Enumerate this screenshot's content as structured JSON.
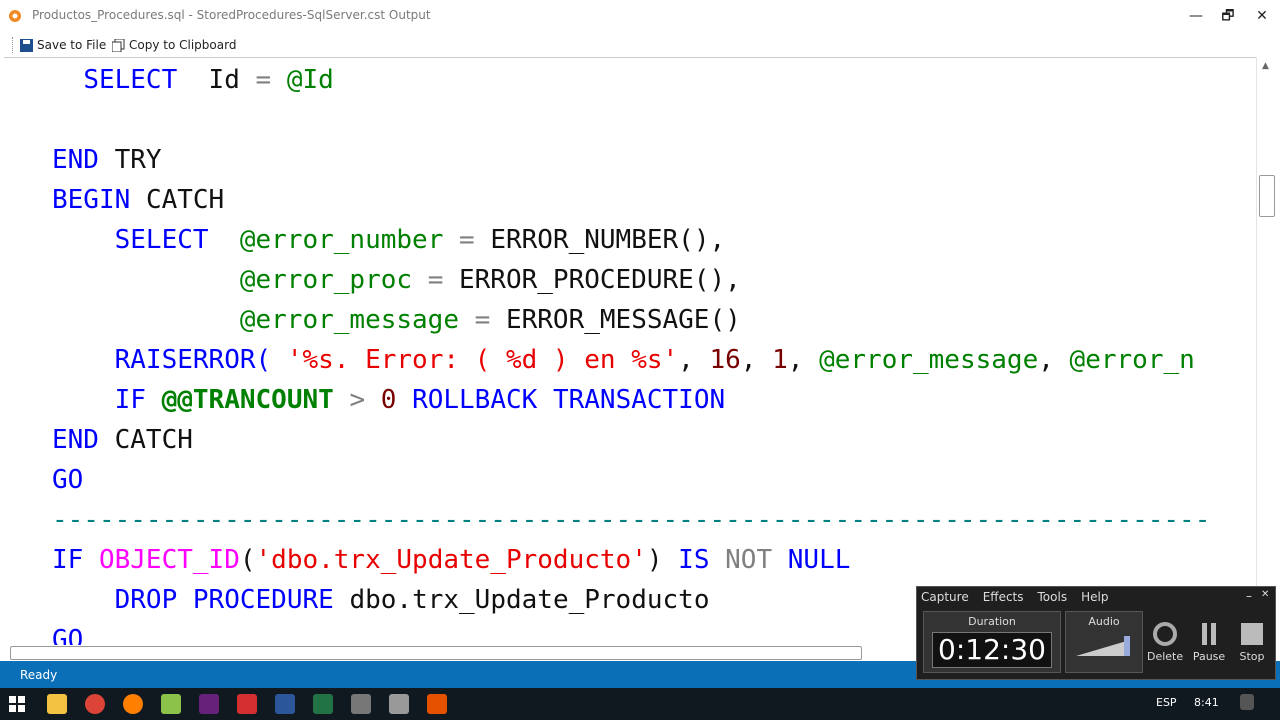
{
  "window": {
    "title": "Productos_Procedures.sql - StoredProcedures-SqlServer.cst Output",
    "minimize": "—",
    "maximize": "🗗",
    "close": "✕"
  },
  "toolbar": {
    "save_label": "Save to File",
    "copy_label": "Copy to Clipboard"
  },
  "code": {
    "l1": [
      "SELECT",
      "Id",
      "=",
      "@Id"
    ],
    "l3": [
      "END",
      "TRY"
    ],
    "l4": [
      "BEGIN",
      "CATCH"
    ],
    "l5": [
      "SELECT",
      "@error_number",
      "=",
      "ERROR_NUMBER(),"
    ],
    "l6": [
      "@error_proc",
      "=",
      "ERROR_PROCEDURE(),"
    ],
    "l7": [
      "@error_message",
      "=",
      "ERROR_MESSAGE()"
    ],
    "l8": [
      "RAISERROR(",
      "'%s. Error: ( %d ) en %s'",
      ",",
      "16",
      ",",
      "1",
      ",",
      "@error_message",
      ",",
      "@error_n"
    ],
    "l9": [
      "IF",
      "@@TRANCOUNT",
      ">",
      "0",
      "ROLLBACK",
      "TRANSACTION"
    ],
    "l10": [
      "END",
      "CATCH"
    ],
    "l11": [
      "GO"
    ],
    "l12": "--------------------------------------------------------------------------",
    "l13": [
      "IF",
      "OBJECT_ID",
      "(",
      "'dbo.trx_Update_Producto'",
      ")",
      "IS",
      "NOT",
      "NULL"
    ],
    "l14": [
      "DROP",
      "PROCEDURE",
      "dbo.trx_Update_Producto"
    ],
    "l15": [
      "GO"
    ]
  },
  "status": {
    "text": "Ready"
  },
  "recorder": {
    "menu": [
      "Capture",
      "Effects",
      "Tools",
      "Help"
    ],
    "duration_label": "Duration",
    "duration_value": "0:12:30",
    "audio_label": "Audio",
    "delete_label": "Delete",
    "pause_label": "Pause",
    "stop_label": "Stop",
    "close": "✕",
    "minimize": "–"
  },
  "taskbar": {
    "language": "ESP",
    "time": "8:41",
    "icons": [
      "windows-start",
      "file-explorer",
      "chrome",
      "firefox",
      "notepad-plus",
      "visual-studio",
      "acrobat",
      "word",
      "excel",
      "app-1",
      "app-2",
      "codesmith"
    ]
  },
  "colors": {
    "keyword": "#0000ff",
    "variable": "#008000",
    "string": "#e80000",
    "status": "#0b6fb8"
  }
}
